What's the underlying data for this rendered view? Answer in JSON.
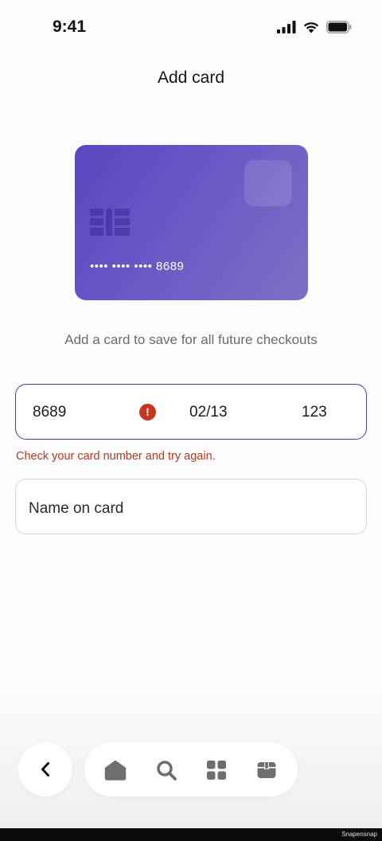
{
  "status_bar": {
    "time": "9:41",
    "icons": [
      "cellular-signal-icon",
      "wifi-icon",
      "battery-icon"
    ]
  },
  "header": {
    "title": "Add card"
  },
  "card_preview": {
    "masked_number": "•••• •••• •••• 8689",
    "gradient_colors": [
      "#5a46c0",
      "#7d70c4"
    ]
  },
  "subtitle": "Add a card to save for all future checkouts",
  "card_input": {
    "number_value": "8689",
    "expiry_value": "02/13",
    "cvc_value": "123",
    "error_icon_glyph": "!",
    "border_color": "#4b3a9e"
  },
  "error_message": "Check your card number and try again.",
  "name_input": {
    "placeholder": "Name on card"
  },
  "bottom_nav": {
    "back_icon": "chevron-left-icon",
    "items": [
      "home-icon",
      "search-icon",
      "grid-icon",
      "package-icon"
    ]
  },
  "footer": {
    "watermark": "Snapensnap"
  },
  "colors": {
    "accent": "#4b3a9e",
    "error": "#c4361f"
  }
}
